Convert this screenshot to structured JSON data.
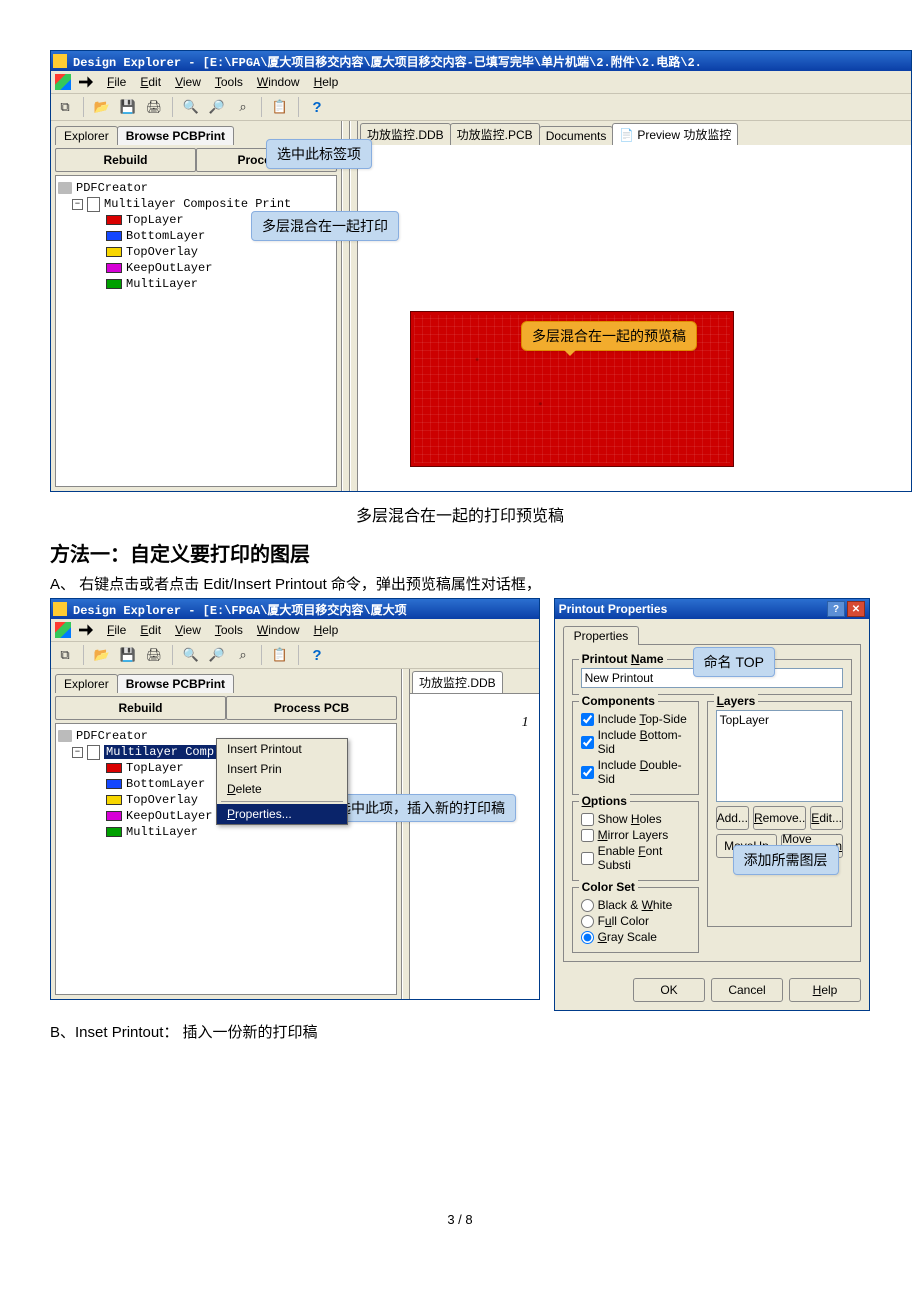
{
  "app1": {
    "title": "Design Explorer - [E:\\FPGA\\厦大项目移交内容\\厦大项目移交内容-已填写完毕\\单片机端\\2.附件\\2.电路\\2.",
    "menus": [
      "File",
      "Edit",
      "View",
      "Tools",
      "Window",
      "Help"
    ],
    "leftTabs": {
      "explorer": "Explorer",
      "browse": "Browse PCBPrint"
    },
    "buttons": {
      "rebuild": "Rebuild",
      "process": "Process P"
    },
    "tree": {
      "root": "PDFCreator",
      "composite": "Multilayer Composite Print",
      "layers": [
        "TopLayer",
        "BottomLayer",
        "TopOverlay",
        "KeepOutLayer",
        "MultiLayer"
      ]
    },
    "docTabs": {
      "t1": "功放监控.DDB",
      "t2": "功放监控.PCB",
      "t3": "Documents",
      "t4": "Preview 功放监控"
    },
    "callouts": {
      "selectTab": "选中此标签项",
      "mixPrint": "多层混合在一起打印",
      "previewDraft": "多层混合在一起的预览稿"
    }
  },
  "caption1": "多层混合在一起的打印预览稿",
  "heading1": "方法一：自定义要打印的图层",
  "stepA": "A、 右键点击或者点击 Edit/Insert Printout 命令，弹出预览稿属性对话框，",
  "app2": {
    "title": "Design Explorer - [E:\\FPGA\\厦大项目移交内容\\厦大项",
    "menus": [
      "File",
      "Edit",
      "View",
      "Tools",
      "Window",
      "Help"
    ],
    "leftTabs": {
      "explorer": "Explorer",
      "browse": "Browse PCBPrint"
    },
    "buttons": {
      "rebuild": "Rebuild",
      "process": "Process PCB"
    },
    "tree": {
      "root": "PDFCreator",
      "compositeSel": "Multilayer Comp",
      "layers": [
        "TopLayer",
        "BottomLayer",
        "TopOverlay",
        "KeepOutLayer",
        "MultiLayer"
      ]
    },
    "ctx": {
      "insertPrintout": "Insert Printout",
      "insertPrin": "Insert Prin",
      "delete": "Delete",
      "properties": "Properties..."
    },
    "docTab": "功放监控.DDB",
    "previewIndex": "1",
    "callout": "选中此项，插入新的打印稿"
  },
  "dlg": {
    "title": "Printout Properties",
    "tab": "Properties",
    "printoutNameLabel": "Printout Name",
    "printoutName": "New Printout",
    "componentsLegend": "Components",
    "incTop": "Include Top-Side",
    "incBottom": "Include Bottom-Sid",
    "incDouble": "Include Double-Sid",
    "layersLegend": "Layers",
    "layersItem": "TopLayer",
    "optionsLegend": "Options",
    "showHoles": "Show Holes",
    "mirror": "Mirror Layers",
    "fontSub": "Enable Font Substi",
    "colorLegend": "Color Set",
    "bw": "Black & White",
    "full": "Full Color",
    "gray": "Gray Scale",
    "add": "Add...",
    "remove": "Remove..",
    "edit": "Edit...",
    "moveUp": "Move Up",
    "moveDown": "Move Down",
    "ok": "OK",
    "cancel": "Cancel",
    "help": "Help",
    "callouts": {
      "nameTop": "命名 TOP",
      "addLayers": "添加所需图层"
    }
  },
  "stepB": "B、Inset Printout： 插入一份新的打印稿",
  "pageNum": "3 / 8"
}
